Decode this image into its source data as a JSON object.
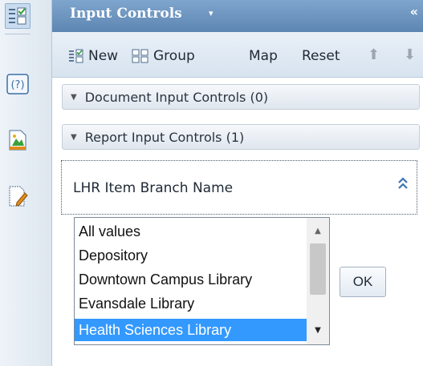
{
  "header": {
    "title": "Input Controls",
    "caret": "▾",
    "collapse": "«"
  },
  "toolbar": {
    "new_label": "New",
    "group_label": "Group",
    "map_label": "Map",
    "reset_label": "Reset",
    "up_glyph": "⬆",
    "down_glyph": "⬇"
  },
  "sections": {
    "document": "Document Input Controls (0)",
    "report": "Report Input Controls (1)",
    "triangle": "▼"
  },
  "control": {
    "title": "LHR Item Branch Name",
    "collapse": "≈"
  },
  "listbox": {
    "items": [
      "All values",
      "Depository",
      "Downtown Campus Library",
      "Evansdale Library",
      "Health Sciences Library"
    ],
    "selected": "Health Sciences Library"
  },
  "ok_label": "OK",
  "icons": {
    "left_bar": [
      "input-controls-icon",
      "help-icon",
      "image-chart-icon",
      "edit-document-icon"
    ],
    "toolbar": [
      "new-icon",
      "group-icon",
      "up-arrow-icon",
      "down-arrow-icon"
    ]
  },
  "colors": {
    "header": "#5d86b2",
    "selected": "#3399ff",
    "accent": "#3a74b3"
  }
}
